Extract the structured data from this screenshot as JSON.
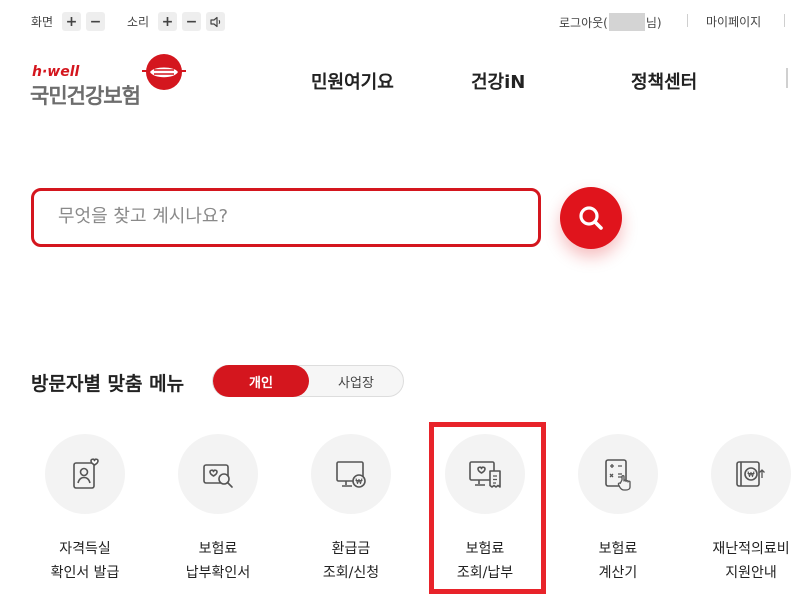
{
  "topbar": {
    "screen_label": "화면",
    "sound_label": "소리",
    "plus": "+",
    "minus": "−",
    "logout_prefix": "로그아웃(",
    "logout_suffix": "님)",
    "mypage": "마이페이지"
  },
  "logo": {
    "hwell": "h·well",
    "name": "국민건강보험"
  },
  "nav": {
    "items": [
      "민원여기요",
      "건강iN",
      "정책센터"
    ]
  },
  "search": {
    "placeholder": "무엇을 찾고 계시나요?"
  },
  "menu": {
    "title": "방문자별 맞춤 메뉴",
    "toggle_personal": "개인",
    "toggle_business": "사업장",
    "tiles": [
      {
        "line1": "자격득실",
        "line2": "확인서 발급",
        "icon": "person-certificate-icon"
      },
      {
        "line1": "보험료",
        "line2": "납부확인서",
        "icon": "search-certificate-icon"
      },
      {
        "line1": "환급금",
        "line2": "조회/신청",
        "icon": "monitor-won-icon"
      },
      {
        "line1": "보험료",
        "line2": "조회/납부",
        "icon": "monitor-receipt-icon"
      },
      {
        "line1": "보험료",
        "line2": "계산기",
        "icon": "calculator-icon"
      },
      {
        "line1": "재난적의료비",
        "line2": "지원안내",
        "icon": "book-won-icon"
      }
    ]
  },
  "colors": {
    "accent": "#d4161e",
    "highlight": "#e8232a"
  }
}
